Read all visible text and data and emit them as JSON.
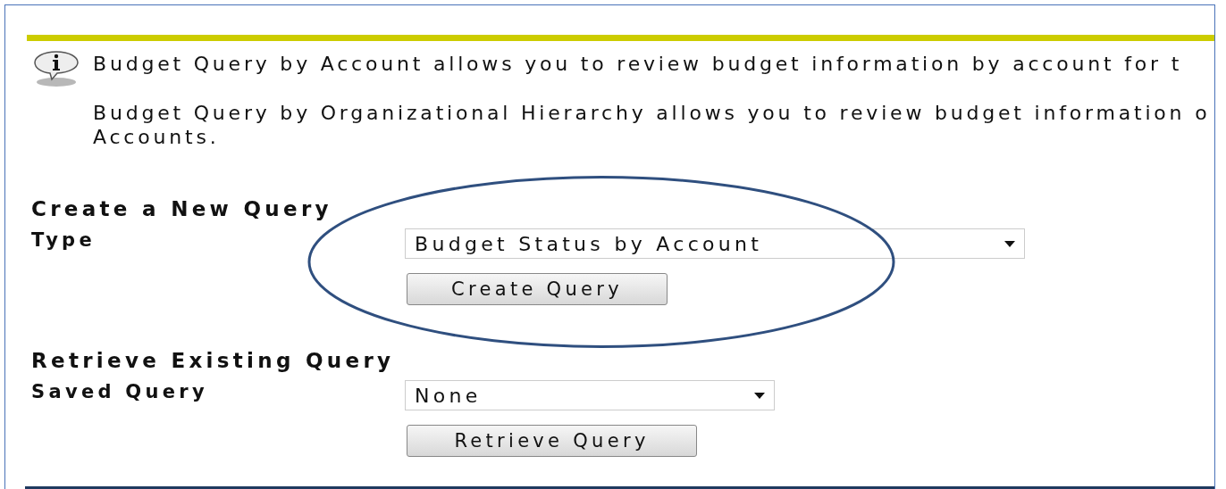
{
  "info": {
    "lines": [
      [
        "Budget Query by Account allows you to review budget information by account for t"
      ],
      [
        "Budget Query by Organizational Hierarchy allows you to review budget information o",
        "Accounts."
      ]
    ]
  },
  "sections": [
    {
      "heading": "Create a New Query",
      "label": "Type",
      "select": "Budget Status by Account",
      "button": "Create Query",
      "highlighted": true
    },
    {
      "heading": "Retrieve Existing Query",
      "label": "Saved Query",
      "select": "None",
      "button": "Retrieve Query",
      "highlighted": false
    }
  ]
}
